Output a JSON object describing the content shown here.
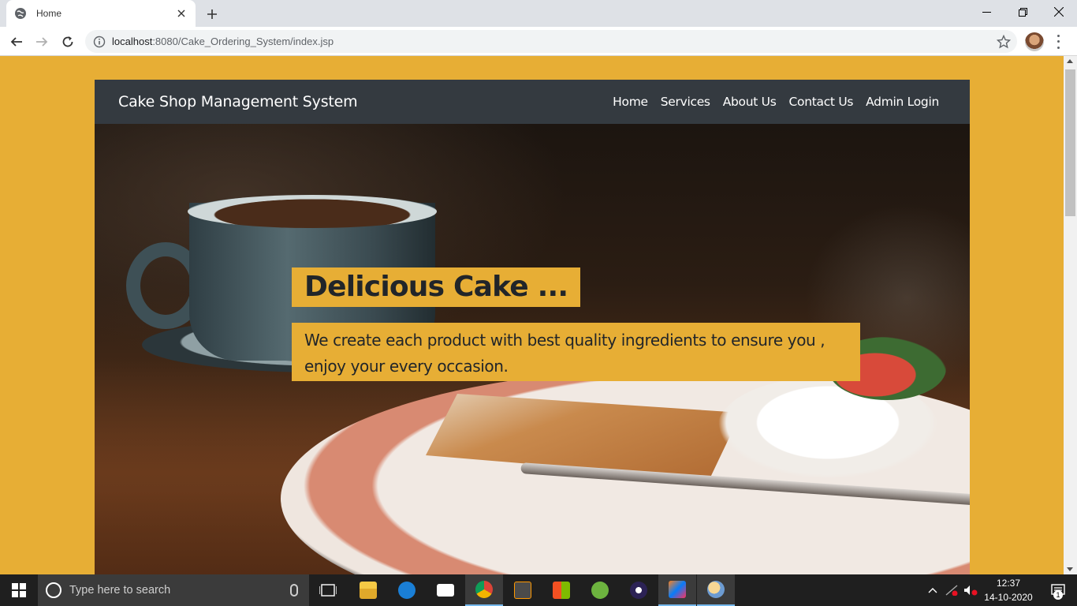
{
  "browser": {
    "tab": {
      "title": "Home",
      "favicon": "globe-icon",
      "close_icon": "close-icon"
    },
    "new_tab_icon": "plus-icon",
    "window_controls": [
      "minimize-icon",
      "restore-icon",
      "close-icon"
    ],
    "nav_icons": [
      "back-arrow-icon",
      "forward-arrow-icon",
      "reload-icon"
    ],
    "address_bar": {
      "info_icon": "info-icon",
      "host": "localhost",
      "rest": ":8080/Cake_Ordering_System/index.jsp"
    },
    "bookmark_icon": "star-icon",
    "menu_icon": "three-dots-icon"
  },
  "page": {
    "background_color": "#e7ae35",
    "navbar_color": "#343a40",
    "brand": "Cake Shop Management System",
    "nav_links": [
      "Home",
      "Services",
      "About Us",
      "Contact Us",
      "Admin Login"
    ],
    "hero": {
      "title": "Delicious Cake ...",
      "subtitle": "We create each product with best quality ingredients to ensure you , enjoy your every occasion."
    }
  },
  "taskbar": {
    "start_icon": "windows-logo-icon",
    "search_placeholder": "Type here to search",
    "apps": [
      "task-view-icon",
      "file-explorer-icon",
      "edge-icon",
      "mail-icon",
      "chrome-icon",
      "sublime-text-icon",
      "store-icon",
      "spring-icon",
      "eclipse-icon",
      "intellij-icon",
      "paint-icon"
    ],
    "time": "12:37",
    "date": "14-10-2020",
    "notification_count": "1"
  }
}
